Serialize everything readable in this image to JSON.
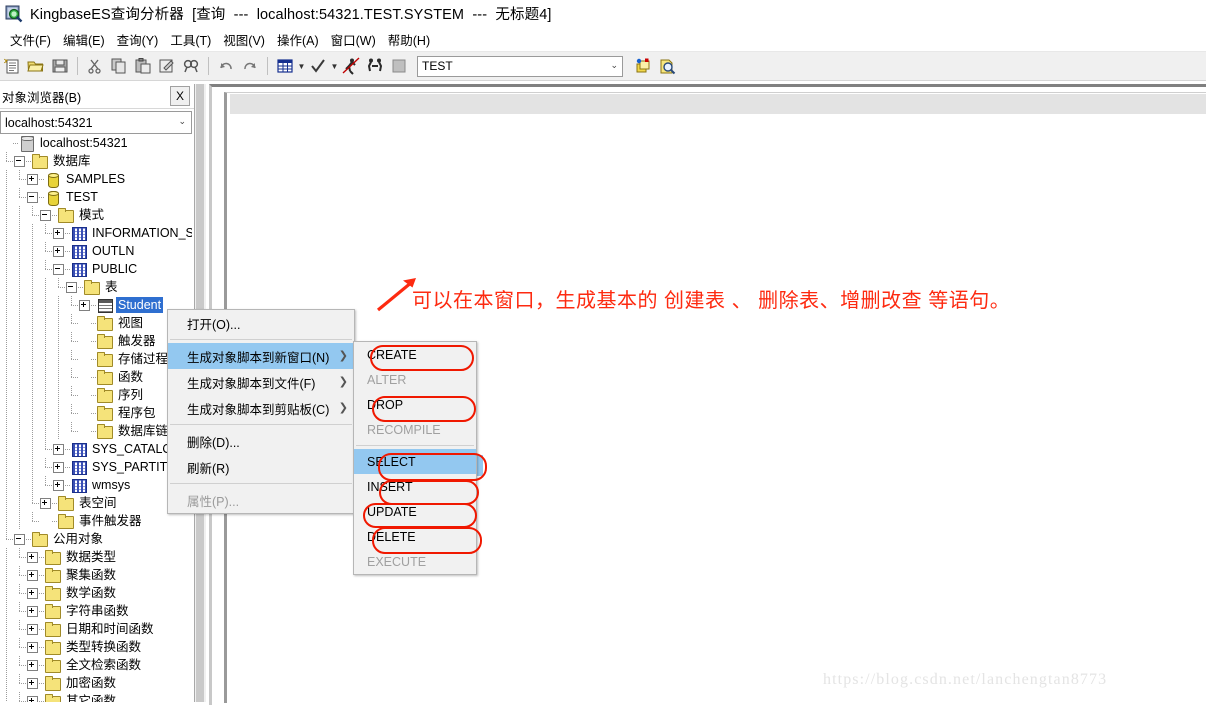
{
  "window": {
    "icon": "app-magnifier-icon",
    "title": "KingbaseES查询分析器  [查询  ---  localhost:54321.TEST.SYSTEM  ---  无标题4]"
  },
  "menubar": {
    "items": [
      {
        "label": "文件(F)"
      },
      {
        "label": "编辑(E)"
      },
      {
        "label": "查询(Y)"
      },
      {
        "label": "工具(T)"
      },
      {
        "label": "视图(V)"
      },
      {
        "label": "操作(A)"
      },
      {
        "label": "窗口(W)"
      },
      {
        "label": "帮助(H)"
      }
    ]
  },
  "toolbar": {
    "buttons": [
      {
        "name": "new-query-icon"
      },
      {
        "name": "open-file-icon"
      },
      {
        "name": "save-icon"
      },
      {
        "name": "cut-icon"
      },
      {
        "name": "copy-icon"
      },
      {
        "name": "paste-icon"
      },
      {
        "name": "clear-icon"
      },
      {
        "name": "find-icon"
      },
      {
        "name": "undo-icon"
      },
      {
        "name": "redo-icon"
      },
      {
        "name": "grid-results-icon"
      },
      {
        "name": "check-syntax-icon"
      },
      {
        "name": "execute-icon"
      },
      {
        "name": "execute-step-icon"
      },
      {
        "name": "stop-icon"
      },
      {
        "name": "object-browser-icon"
      },
      {
        "name": "object-search-icon"
      }
    ],
    "connection": {
      "value": "TEST",
      "placeholder": "TEST"
    }
  },
  "sidebar": {
    "title": "对象浏览器(B)",
    "close_label": "X",
    "connection": "localhost:54321",
    "tree": [
      {
        "label": "localhost:54321",
        "depth": 0,
        "icon": "server-icon",
        "expander": "none"
      },
      {
        "label": "数据库",
        "depth": 1,
        "icon": "folder-icon",
        "expander": "minus"
      },
      {
        "label": "SAMPLES",
        "depth": 2,
        "icon": "database-icon",
        "expander": "plus"
      },
      {
        "label": "TEST",
        "depth": 2,
        "icon": "database-icon",
        "expander": "minus"
      },
      {
        "label": "模式",
        "depth": 3,
        "icon": "folder-icon",
        "expander": "minus"
      },
      {
        "label": "INFORMATION_SC",
        "depth": 4,
        "icon": "schema-icon",
        "expander": "plus"
      },
      {
        "label": "OUTLN",
        "depth": 4,
        "icon": "schema-icon",
        "expander": "plus"
      },
      {
        "label": "PUBLIC",
        "depth": 4,
        "icon": "schema-icon",
        "expander": "minus"
      },
      {
        "label": "表",
        "depth": 5,
        "icon": "folder-icon",
        "expander": "minus"
      },
      {
        "label": "Student",
        "depth": 6,
        "icon": "table-icon",
        "expander": "plus",
        "selected": true
      },
      {
        "label": "视图",
        "depth": 6,
        "icon": "folder-icon",
        "expander": "none"
      },
      {
        "label": "触发器",
        "depth": 6,
        "icon": "folder-icon",
        "expander": "none"
      },
      {
        "label": "存储过程",
        "depth": 6,
        "icon": "folder-icon",
        "expander": "none"
      },
      {
        "label": "函数",
        "depth": 6,
        "icon": "folder-icon",
        "expander": "none"
      },
      {
        "label": "序列",
        "depth": 6,
        "icon": "folder-icon",
        "expander": "none"
      },
      {
        "label": "程序包",
        "depth": 6,
        "icon": "folder-icon",
        "expander": "none"
      },
      {
        "label": "数据库链接",
        "depth": 6,
        "icon": "folder-icon",
        "expander": "none"
      },
      {
        "label": "SYS_CATALOG",
        "depth": 4,
        "icon": "schema-icon",
        "expander": "plus"
      },
      {
        "label": "SYS_PARTITION",
        "depth": 4,
        "icon": "schema-icon",
        "expander": "plus"
      },
      {
        "label": "wmsys",
        "depth": 4,
        "icon": "schema-icon",
        "expander": "plus"
      },
      {
        "label": "表空间",
        "depth": 3,
        "icon": "folder-icon",
        "expander": "plus"
      },
      {
        "label": "事件触发器",
        "depth": 3,
        "icon": "folder-icon",
        "expander": "none"
      },
      {
        "label": "公用对象",
        "depth": 1,
        "icon": "folder-icon",
        "expander": "minus"
      },
      {
        "label": "数据类型",
        "depth": 2,
        "icon": "folder-icon",
        "expander": "plus"
      },
      {
        "label": "聚集函数",
        "depth": 2,
        "icon": "folder-icon",
        "expander": "plus"
      },
      {
        "label": "数学函数",
        "depth": 2,
        "icon": "folder-icon",
        "expander": "plus"
      },
      {
        "label": "字符串函数",
        "depth": 2,
        "icon": "folder-icon",
        "expander": "plus"
      },
      {
        "label": "日期和时间函数",
        "depth": 2,
        "icon": "folder-icon",
        "expander": "plus"
      },
      {
        "label": "类型转换函数",
        "depth": 2,
        "icon": "folder-icon",
        "expander": "plus"
      },
      {
        "label": "全文检索函数",
        "depth": 2,
        "icon": "folder-icon",
        "expander": "plus"
      },
      {
        "label": "加密函数",
        "depth": 2,
        "icon": "folder-icon",
        "expander": "plus"
      },
      {
        "label": "其它函数",
        "depth": 2,
        "icon": "folder-icon",
        "expander": "plus"
      }
    ]
  },
  "context_menu": {
    "items": [
      {
        "label": "打开(O)...",
        "disabled": false,
        "submenu": false,
        "highlight": false
      },
      {
        "separator": true
      },
      {
        "label": "生成对象脚本到新窗口(N)",
        "disabled": false,
        "submenu": true,
        "highlight": true
      },
      {
        "label": "生成对象脚本到文件(F)",
        "disabled": false,
        "submenu": true,
        "highlight": false
      },
      {
        "label": "生成对象脚本到剪贴板(C)",
        "disabled": false,
        "submenu": true,
        "highlight": false
      },
      {
        "separator": true
      },
      {
        "label": "删除(D)...",
        "disabled": false,
        "submenu": false,
        "highlight": false
      },
      {
        "label": "刷新(R)",
        "disabled": false,
        "submenu": false,
        "highlight": false
      },
      {
        "separator": true
      },
      {
        "label": "属性(P)...",
        "disabled": true,
        "submenu": false,
        "highlight": false
      }
    ],
    "submenu": {
      "items": [
        {
          "label": "CREATE",
          "disabled": false,
          "circled": true
        },
        {
          "label": "ALTER",
          "disabled": true,
          "circled": false
        },
        {
          "label": "DROP",
          "disabled": false,
          "circled": true
        },
        {
          "label": "RECOMPILE",
          "disabled": true,
          "circled": false
        },
        {
          "separator": true
        },
        {
          "label": "SELECT",
          "disabled": false,
          "circled": true,
          "highlight": true
        },
        {
          "label": "INSERT",
          "disabled": false,
          "circled": true
        },
        {
          "label": "UPDATE",
          "disabled": false,
          "circled": true
        },
        {
          "label": "DELETE",
          "disabled": false,
          "circled": true
        },
        {
          "label": "EXECUTE",
          "disabled": true,
          "circled": false
        }
      ]
    }
  },
  "annotation": {
    "text": "可以在本窗口，生成基本的 创建表 、 删除表、增删改查 等语句。",
    "color": "#fd2a10",
    "arrow": "red-arrow-icon"
  },
  "watermark": {
    "text": "https://blog.csdn.net/lanchengtan8773"
  }
}
